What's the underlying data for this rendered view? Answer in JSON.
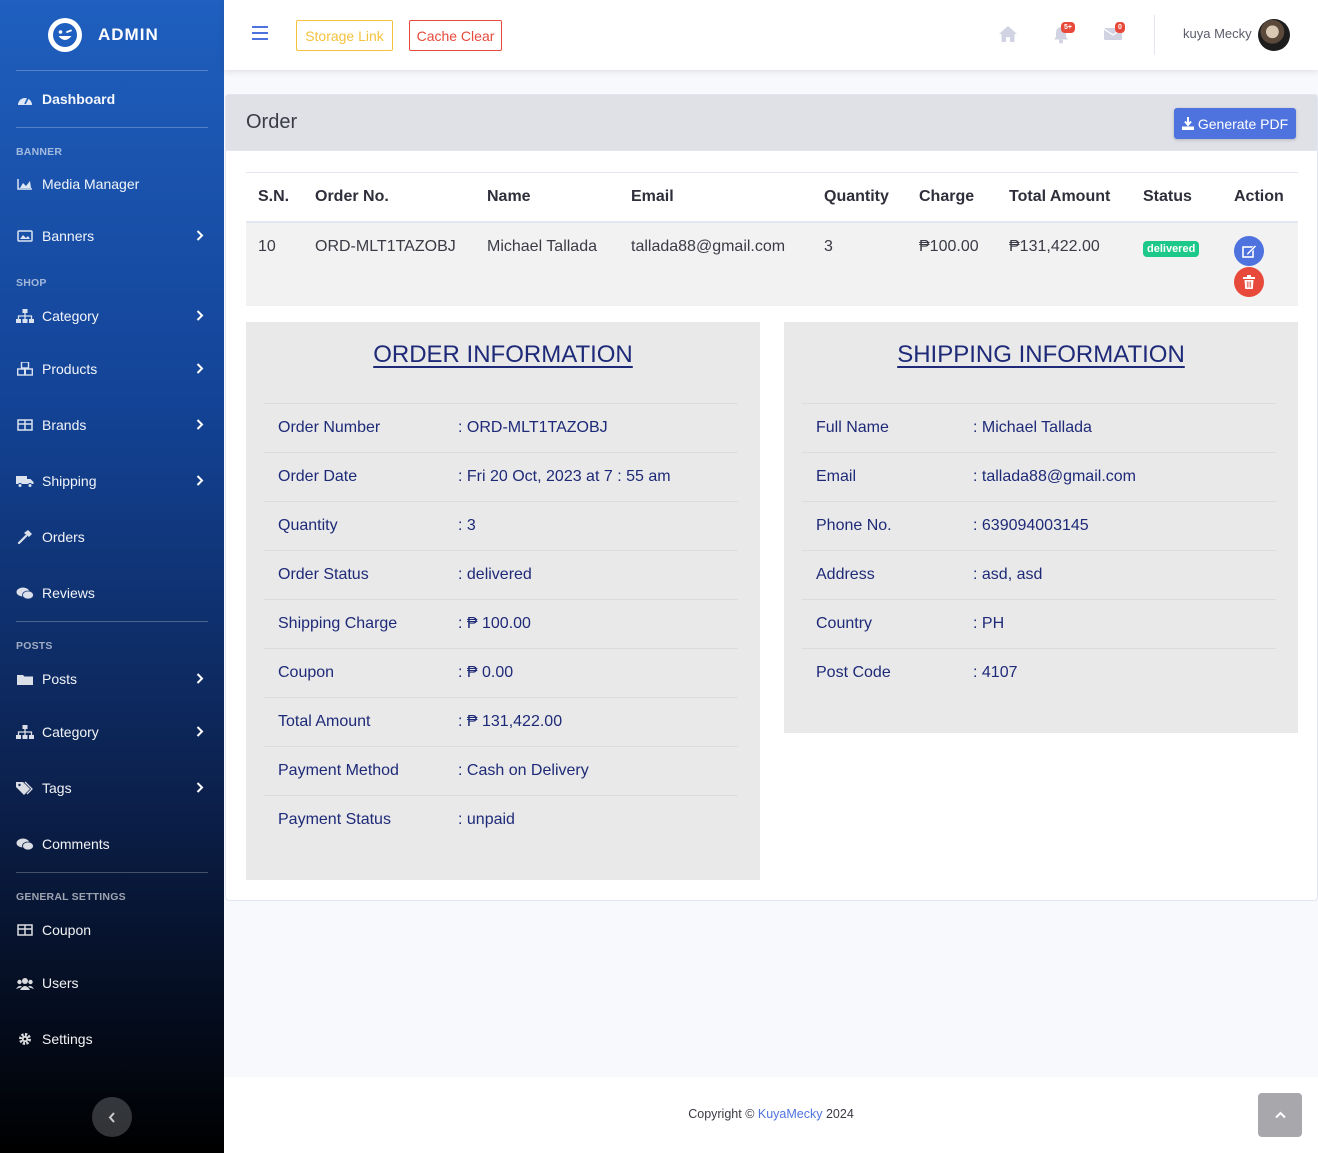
{
  "brand": {
    "name": "ADMIN",
    "logo_icon": "laugh-wink-icon"
  },
  "sidebar": {
    "dashboard": "Dashboard",
    "sections": {
      "banner": "BANNER",
      "shop": "SHOP",
      "posts": "POSTS",
      "general": "GENERAL SETTINGS"
    },
    "items": {
      "media": "Media Manager",
      "banners": "Banners",
      "category_shop": "Category",
      "products": "Products",
      "brands": "Brands",
      "shipping": "Shipping",
      "orders": "Orders",
      "reviews": "Reviews",
      "posts": "Posts",
      "category_posts": "Category",
      "tags": "Tags",
      "comments": "Comments",
      "coupon": "Coupon",
      "users": "Users",
      "settings": "Settings"
    }
  },
  "topbar": {
    "storage_link": "Storage Link",
    "cache_clear": "Cache Clear",
    "alerts_count": "5+",
    "messages_count": "0",
    "user_name": "kuya Mecky"
  },
  "card": {
    "title": "Order",
    "pdf_button": "Generate PDF"
  },
  "orders_table": {
    "headers": [
      "S.N.",
      "Order No.",
      "Name",
      "Email",
      "Quantity",
      "Charge",
      "Total Amount",
      "Status",
      "Action"
    ],
    "row": {
      "sn": "10",
      "order_no": "ORD-MLT1TAZOBJ",
      "name": "Michael Tallada",
      "email": "tallada88@gmail.com",
      "quantity": "3",
      "charge": "₱100.00",
      "total": "₱131,422.00",
      "status": "delivered"
    }
  },
  "order_info": {
    "heading": "ORDER INFORMATION",
    "rows": [
      {
        "label": "Order Number",
        "value": ": ORD-MLT1TAZOBJ"
      },
      {
        "label": "Order Date",
        "value": ": Fri 20 Oct, 2023 at 7 : 55 am"
      },
      {
        "label": "Quantity",
        "value": ": 3"
      },
      {
        "label": "Order Status",
        "value": ": delivered"
      },
      {
        "label": "Shipping Charge",
        "value": ": ₱ 100.00"
      },
      {
        "label": "Coupon",
        "value": ": ₱ 0.00"
      },
      {
        "label": "Total Amount",
        "value": ": ₱ 131,422.00"
      },
      {
        "label": "Payment Method",
        "value": ": Cash on Delivery"
      },
      {
        "label": "Payment Status",
        "value": ": unpaid"
      }
    ]
  },
  "shipping_info": {
    "heading": "SHIPPING INFORMATION",
    "rows": [
      {
        "label": "Full Name",
        "value": ": Michael Tallada"
      },
      {
        "label": "Email",
        "value": ": tallada88@gmail.com"
      },
      {
        "label": "Phone No.",
        "value": ": 639094003145"
      },
      {
        "label": "Address",
        "value": ": asd, asd"
      },
      {
        "label": "Country",
        "value": ": PH"
      },
      {
        "label": "Post Code",
        "value": ": 4107"
      }
    ]
  },
  "footer": {
    "copyright_prefix": "Copyright © ",
    "copyright_link": "KuyaMecky",
    "copyright_year": " 2024"
  },
  "colors": {
    "primary": "#4e73df",
    "danger": "#e74a3b",
    "warning": "#f6c23e",
    "success": "#1cc88a",
    "heading_navy": "#1e2a78"
  }
}
